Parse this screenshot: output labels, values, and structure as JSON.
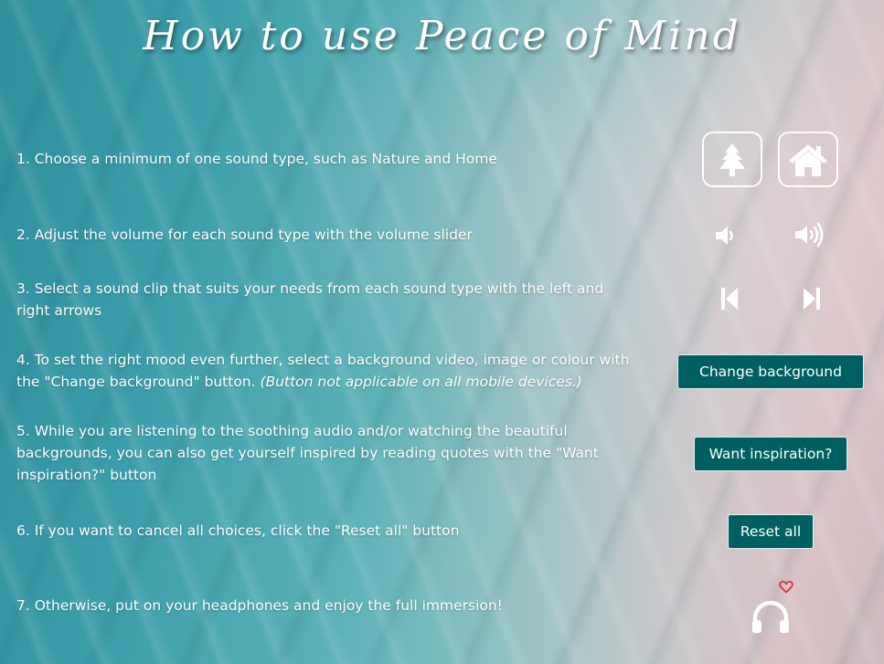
{
  "page": {
    "title": "How to use Peace of Mind"
  },
  "steps": [
    "1. Choose a minimum of one sound type, such as Nature and Home",
    "2. Adjust the volume for each sound type with the volume slider",
    "3. Select a sound clip that suits your needs from each sound type with the left and right arrows",
    "4. To set the right mood even further, select a background video, image or colour with the \"Change background\" button. ",
    "5. While you are listening to the soothing audio and/or watching the beautiful backgrounds, you can also get yourself inspired by reading quotes with the \"Want inspiration?\" button",
    "6. If you want to cancel all choices, click the \"Reset all\" button",
    "7. Otherwise, put on your headphones and enjoy the full immersion!"
  ],
  "step4_note": "(Button not applicable on all mobile devices.)",
  "buttons": {
    "change_background": "Change background",
    "want_inspiration": "Want inspiration?",
    "reset_all": "Reset all"
  },
  "icons": {
    "nature": "tree-icon",
    "home": "house-icon",
    "volume_down": "volume-down-icon",
    "volume_up": "volume-up-icon",
    "previous": "skip-back-icon",
    "next": "skip-forward-icon",
    "heart": "heart-icon",
    "headphones": "headphones-icon"
  },
  "colors": {
    "button_bg": "#005f63",
    "heart": "#e0323a",
    "text": "#ffffff"
  }
}
